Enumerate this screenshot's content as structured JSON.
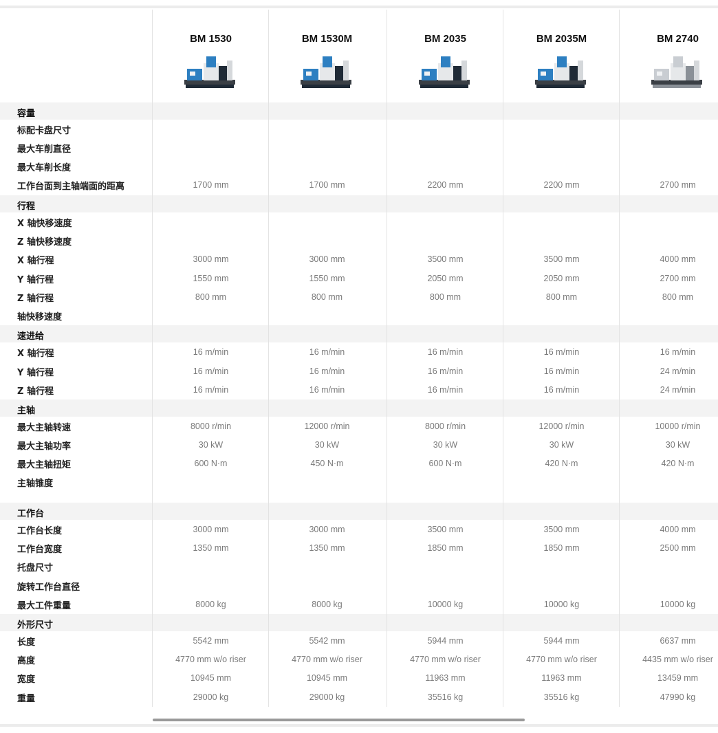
{
  "models": [
    "BM 1530",
    "BM 1530M",
    "BM 2035",
    "BM 2035M",
    "BM 2740"
  ],
  "sections": [
    {
      "title": "容量",
      "rows": [
        {
          "label": "标配卡盘尺寸",
          "values": [
            "",
            "",
            "",
            "",
            ""
          ]
        },
        {
          "label": "最大车削直径",
          "values": [
            "",
            "",
            "",
            "",
            ""
          ]
        },
        {
          "label": "最大车削长度",
          "values": [
            "",
            "",
            "",
            "",
            ""
          ]
        },
        {
          "label": "工作台面到主轴端面的距离",
          "values": [
            "1700 mm",
            "1700 mm",
            "2200 mm",
            "2200 mm",
            "2700 mm"
          ]
        }
      ]
    },
    {
      "title": "行程",
      "rows": [
        {
          "label": "X 轴快移速度",
          "values": [
            "",
            "",
            "",
            "",
            ""
          ]
        },
        {
          "label": "Z 轴快移速度",
          "values": [
            "",
            "",
            "",
            "",
            ""
          ]
        },
        {
          "label": "X 轴行程",
          "values": [
            "3000 mm",
            "3000 mm",
            "3500 mm",
            "3500 mm",
            "4000 mm"
          ]
        },
        {
          "label": "Y 轴行程",
          "values": [
            "1550 mm",
            "1550 mm",
            "2050 mm",
            "2050 mm",
            "2700 mm"
          ]
        },
        {
          "label": "Z 轴行程",
          "values": [
            "800 mm",
            "800 mm",
            "800 mm",
            "800 mm",
            "800 mm"
          ]
        },
        {
          "label": "轴快移速度",
          "values": [
            "",
            "",
            "",
            "",
            ""
          ]
        }
      ]
    },
    {
      "title": "速进给",
      "rows": [
        {
          "label": "X 轴行程",
          "values": [
            "16 m/min",
            "16 m/min",
            "16 m/min",
            "16 m/min",
            "16 m/min"
          ]
        },
        {
          "label": "Y 轴行程",
          "values": [
            "16 m/min",
            "16 m/min",
            "16 m/min",
            "16 m/min",
            "24 m/min"
          ]
        },
        {
          "label": "Z 轴行程",
          "values": [
            "16 m/min",
            "16 m/min",
            "16 m/min",
            "16 m/min",
            "24 m/min"
          ]
        }
      ]
    },
    {
      "title": "主轴",
      "rows": [
        {
          "label": "最大主轴转速",
          "values": [
            "8000 r/min",
            "12000 r/min",
            "8000 r/min",
            "12000 r/min",
            "10000 r/min"
          ]
        },
        {
          "label": "最大主轴功率",
          "values": [
            "30 kW",
            "30 kW",
            "30 kW",
            "30 kW",
            "30 kW"
          ]
        },
        {
          "label": "最大主轴扭矩",
          "values": [
            "600 N·m",
            "450 N·m",
            "600 N·m",
            "420 N·m",
            "420 N·m"
          ]
        },
        {
          "label": "主轴锥度",
          "values": [
            "",
            "",
            "",
            "",
            ""
          ]
        }
      ]
    },
    {
      "title": "工作台",
      "rows": [
        {
          "label": "工作台长度",
          "values": [
            "3000 mm",
            "3000 mm",
            "3500 mm",
            "3500 mm",
            "4000 mm"
          ]
        },
        {
          "label": "工作台宽度",
          "values": [
            "1350 mm",
            "1350 mm",
            "1850 mm",
            "1850 mm",
            "2500 mm"
          ]
        },
        {
          "label": "托盘尺寸",
          "values": [
            "",
            "",
            "",
            "",
            ""
          ]
        },
        {
          "label": "旋转工作台直径",
          "values": [
            "",
            "",
            "",
            "",
            ""
          ]
        },
        {
          "label": "最大工件重量",
          "values": [
            "8000 kg",
            "8000 kg",
            "10000 kg",
            "10000 kg",
            "10000 kg"
          ]
        }
      ]
    },
    {
      "title": "外形尺寸",
      "rows": [
        {
          "label": "长度",
          "values": [
            "5542 mm",
            "5542 mm",
            "5944 mm",
            "5944 mm",
            "6637 mm"
          ]
        },
        {
          "label": "高度",
          "values": [
            "4770 mm w/o riser",
            "4770 mm w/o riser",
            "4770 mm w/o riser",
            "4770 mm w/o riser",
            "4435 mm w/o riser"
          ]
        },
        {
          "label": "宽度",
          "values": [
            "10945 mm",
            "10945 mm",
            "11963 mm",
            "11963 mm",
            "13459 mm"
          ]
        },
        {
          "label": "重量",
          "values": [
            "29000 kg",
            "29000 kg",
            "35516 kg",
            "35516 kg",
            "47990 kg"
          ]
        }
      ]
    }
  ],
  "colors": {
    "accent_blue": "#2d7fc1",
    "header_bg": "#f3f3f3",
    "value_text": "#7a7a7a"
  },
  "icons": {
    "machine": "gantry-machining-center-image"
  }
}
